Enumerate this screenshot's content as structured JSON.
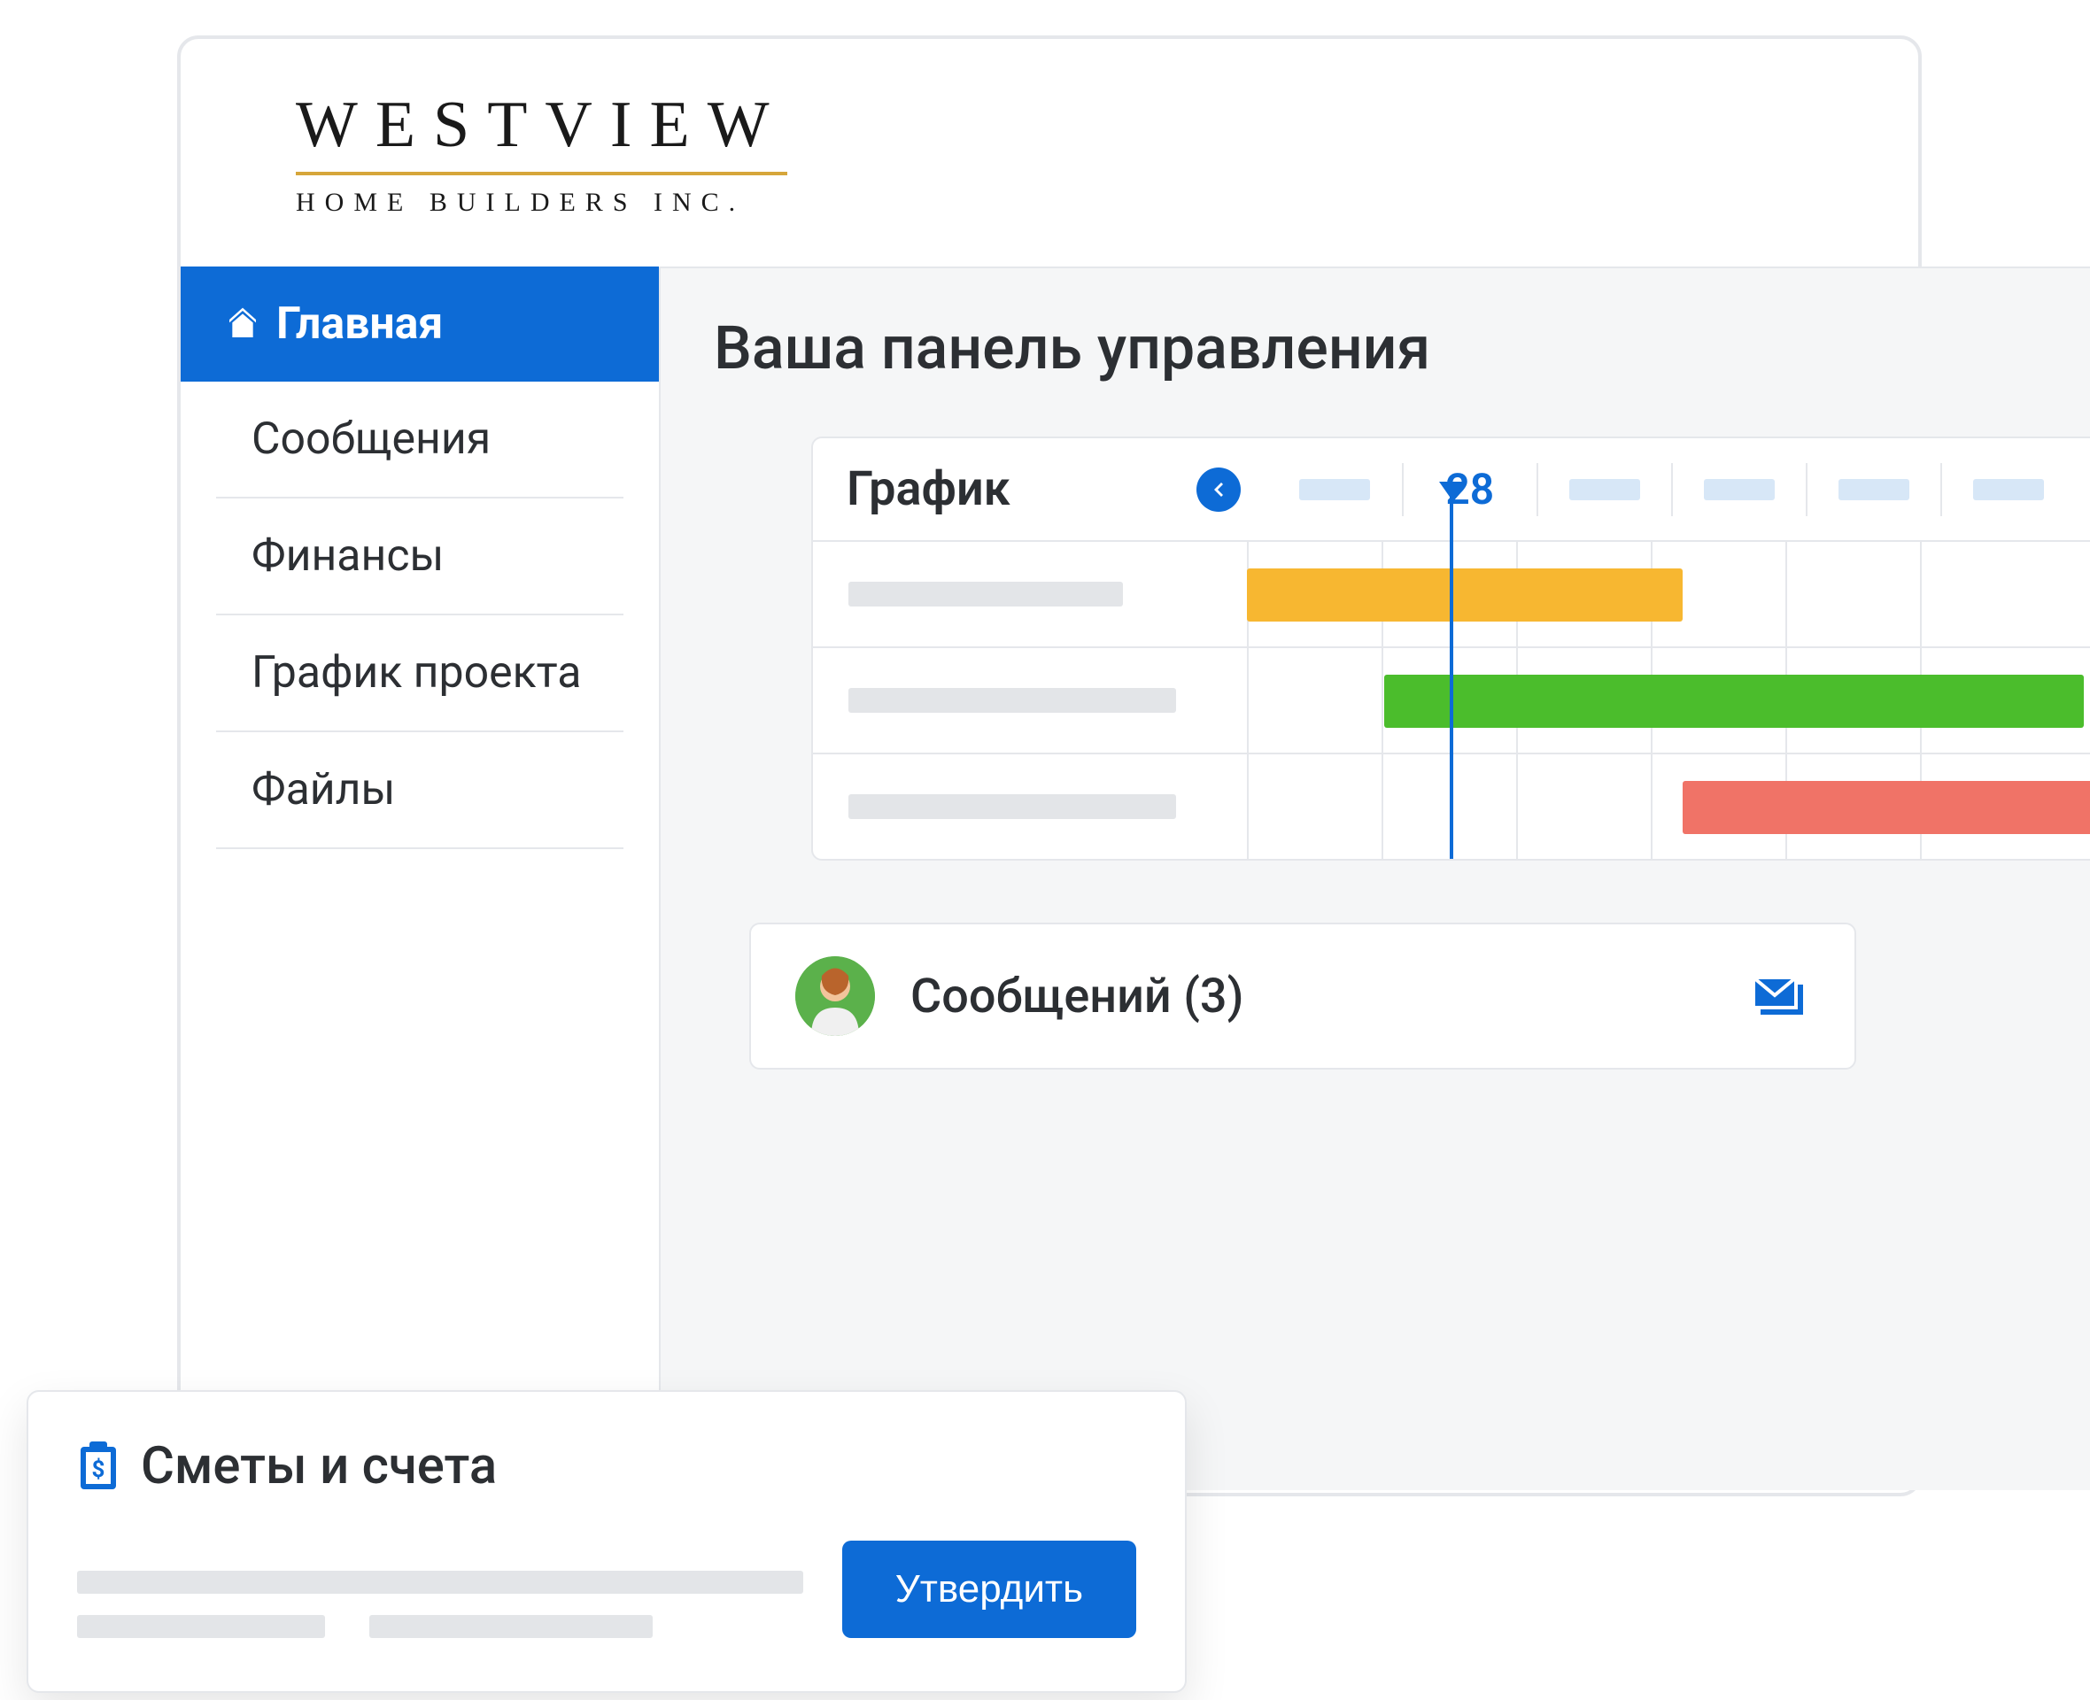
{
  "brand": {
    "name": "WESTVIEW",
    "subtitle": "HOME BUILDERS INC."
  },
  "sidebar": {
    "items": [
      {
        "label": "Главная",
        "active": true,
        "icon": "home-icon"
      },
      {
        "label": "Сообщения",
        "active": false
      },
      {
        "label": "Финансы",
        "active": false
      },
      {
        "label": "График проекта",
        "active": false
      },
      {
        "label": "Файлы",
        "active": false
      }
    ]
  },
  "dashboard": {
    "title": "Ваша панель управления"
  },
  "schedule": {
    "title": "График",
    "current_date": "28",
    "bars": [
      {
        "color": "yellow"
      },
      {
        "color": "green"
      },
      {
        "color": "red"
      }
    ]
  },
  "messages": {
    "label": "Сообщений (3)",
    "count": 3
  },
  "invoices": {
    "title": "Сметы и счета",
    "approve_label": "Утвердить"
  },
  "colors": {
    "primary": "#0d6bd6",
    "yellow": "#f7b731",
    "green": "#4bbd2c",
    "red": "#f07367",
    "accent_gold": "#d6a63a"
  }
}
